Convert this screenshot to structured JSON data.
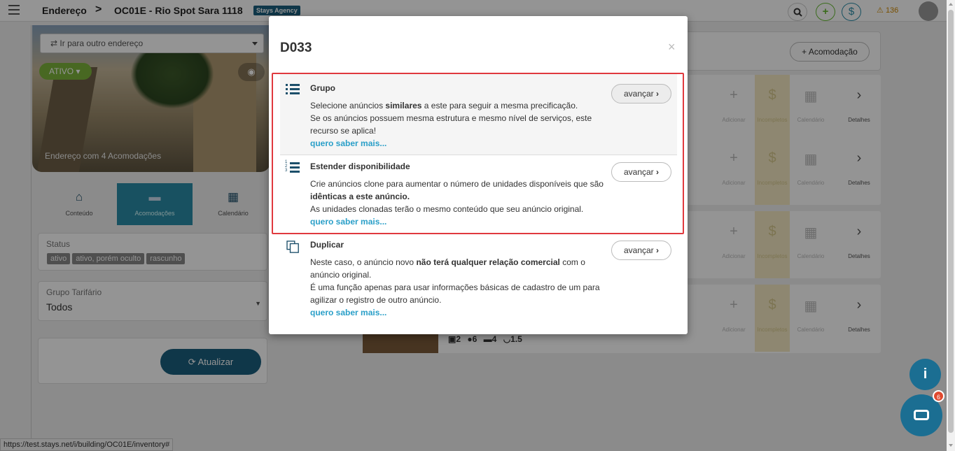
{
  "topbar": {
    "breadcrumb_root": "Endereço",
    "breadcrumb_sep": ">",
    "breadcrumb_current": "OC01E - Rio Spot Sara 1118",
    "agency_badge": "Stays Agency",
    "add_symbol": "+",
    "currency_symbol": "$",
    "alerts_count": "136"
  },
  "sidebar": {
    "address_select": "Ir para outro endereço",
    "status_toggle": "ATIVO",
    "hero_caption": "Endereço com 4 Acomodações",
    "tabs": [
      {
        "label": "Conteúdo",
        "icon": "home-icon"
      },
      {
        "label": "Acomodações",
        "icon": "bed-icon"
      },
      {
        "label": "Calendário",
        "icon": "calendar-icon"
      }
    ],
    "status_label": "Status",
    "status_chips": [
      "ativo",
      "ativo, porém oculto",
      "rascunho"
    ],
    "rate_group_label": "Grupo Tarifário",
    "rate_group_value": "Todos",
    "refresh_button": "Atualizar"
  },
  "main": {
    "add_accommodation": "Acomodação",
    "row_actions": [
      "Adicionar",
      "Incompletos",
      "Calendário",
      "Detalhes"
    ],
    "row_stats": {
      "rooms": "2",
      "guests": "6",
      "beds": "4",
      "baths": "1.5"
    }
  },
  "modal": {
    "title": "D033",
    "close": "×",
    "options": [
      {
        "title": "Grupo",
        "icon": "list-icon",
        "lines": [
          "Selecione anúncios ",
          "similares",
          " a este para seguir a mesma precificação.",
          "Se os anúncios possuem mesma estrutura e mesmo nível de serviços, este recurso se aplica!"
        ],
        "more": "quero saber mais...",
        "button": "avançar"
      },
      {
        "title": "Estender disponibilidade",
        "icon": "ordered-list-icon",
        "lines": [
          "Crie anúncios clone para aumentar o número de unidades disponíveis que são ",
          "idênticas a este anúncio.",
          "As unidades clonadas terão o mesmo conteúdo que seu anúncio original."
        ],
        "more": "quero saber mais...",
        "button": "avançar"
      },
      {
        "title": "Duplicar",
        "icon": "copy-icon",
        "lines": [
          "Neste caso, o anúncio novo ",
          "não terá qualquer relação comercial",
          " com o anúncio original.",
          "É uma função apenas para usar informações básicas de cadastro de um para agilizar o registro de outro anúncio."
        ],
        "more": "quero saber mais...",
        "button": "avançar"
      }
    ]
  },
  "fab": {
    "info": "i",
    "chat_badge": "6"
  },
  "status_bar_url": "https://test.stays.net/i/building/OC01E/inventory#"
}
